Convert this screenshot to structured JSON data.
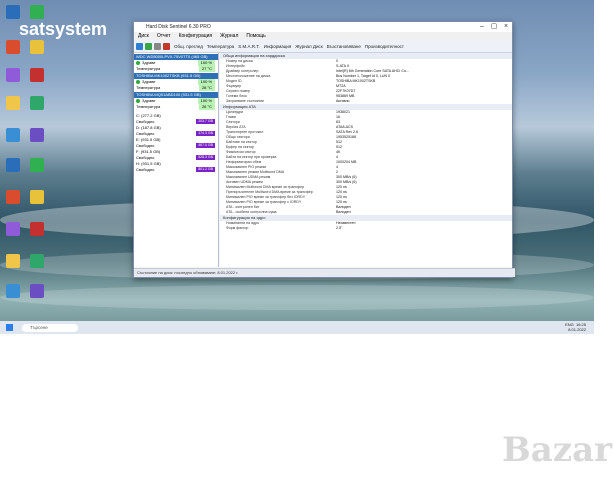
{
  "desktop": {
    "watermark": "satsystem",
    "icons": [
      {
        "label": "",
        "color": "#2a6db8"
      },
      {
        "label": "",
        "color": "#30b050"
      },
      {
        "label": "",
        "color": "#d94d2e"
      },
      {
        "label": "",
        "color": "#e8c23a"
      },
      {
        "label": "",
        "color": "#8f5bd8"
      },
      {
        "label": "",
        "color": "#c23030"
      },
      {
        "label": "",
        "color": "#f0c64a"
      },
      {
        "label": "",
        "color": "#2fa66a"
      },
      {
        "label": "",
        "color": "#3a8fd4"
      },
      {
        "label": "",
        "color": "#6a4ec2"
      }
    ]
  },
  "window": {
    "title": "Hard Disk Sentinel 6.30 PRO",
    "menu": [
      "Диск",
      "Отчет",
      "Конфигурация",
      "Журнал",
      "Помощь"
    ],
    "tabs": [
      "Общ. преглед",
      "Температура",
      "S.M.A.R.T.",
      "Информация",
      "Журнал Диск",
      "Възстановяване",
      "Производителност"
    ],
    "disks": [
      {
        "header": "WDC WD5000LPVX-75V0TT0 (465 GB)",
        "health": "100 %",
        "temp": "27 °C",
        "health_label": "Здраве",
        "temp_label": "Температура"
      },
      {
        "header": "TOSHIBA MK1002TSKB (931.5 GB)",
        "health": "100 %",
        "temp": "28 °C",
        "health_label": "Здраве",
        "temp_label": "Температура"
      },
      {
        "header": "TOSHIBA MQ01ABD100 (931.5 GB)",
        "health": "100 %",
        "temp": "26 °C",
        "health_label": "Здраве",
        "temp_label": "Температура"
      }
    ],
    "partitions": [
      {
        "letter": "C:",
        "size": "(277.2 GB)",
        "free_label": "Свободно",
        "free": "203.7 GB"
      },
      {
        "letter": "D:",
        "size": "(187.8 GB)",
        "free_label": "Свободно",
        "free": "174.3 GB"
      },
      {
        "letter": "E:",
        "size": "(931.5 GB)",
        "free_label": "Свободно",
        "free": "467.0 GB"
      },
      {
        "letter": "F:",
        "size": "(931.5 GB)",
        "free_label": "Свободно",
        "free": "528.3 GB"
      },
      {
        "letter": "H:",
        "size": "(931.5 GB)",
        "free_label": "Свободно",
        "free": "801.2 GB"
      }
    ],
    "info_section1": "Обща информация на харддиска",
    "info1": [
      {
        "k": "Номер на диска",
        "v": "0"
      },
      {
        "k": "Интерфейс",
        "v": "S-ATA II"
      },
      {
        "k": "Драйвер контролер",
        "v": "Intel(R) 6th Generation Core SATA AHCI Co..."
      },
      {
        "k": "Местоположение на диска",
        "v": "Bus Number 1, Target Id 0, LUN 0"
      },
      {
        "k": "Модел ID",
        "v": "TOSHIBA MK1002TSKB"
      },
      {
        "k": "Фърмуер",
        "v": "MT2A"
      },
      {
        "k": "Сериен номер",
        "v": "22F7K07DT"
      },
      {
        "k": "Големи блок",
        "v": "953869 MB"
      },
      {
        "k": "Захранване състояние",
        "v": "Активно"
      }
    ],
    "info_section2": "Информация ATA",
    "info2": [
      {
        "k": "Цилиндри",
        "v": "1938021"
      },
      {
        "k": "Глави",
        "v": "16"
      },
      {
        "k": "Сектори",
        "v": "63"
      },
      {
        "k": "Версия ATA",
        "v": "ATA8-ACS"
      },
      {
        "k": "Транспортен протокол",
        "v": "SATA Rev 2.6"
      },
      {
        "k": "Общо сектори",
        "v": "1953525168"
      },
      {
        "k": "Байтове на сектор",
        "v": "512"
      },
      {
        "k": "Буфер на сектор",
        "v": "512"
      },
      {
        "k": "Физически сектор",
        "v": "4K"
      },
      {
        "k": "Байта на сектор при проверка",
        "v": "4"
      },
      {
        "k": "Неформатиран обем",
        "v": "1000204 MB"
      },
      {
        "k": "Максимален PIO режим",
        "v": "4"
      },
      {
        "k": "Максимален режим Multiword DMA",
        "v": "2"
      },
      {
        "k": "Максимален UDMA режим",
        "v": "300 MB/s (6)"
      },
      {
        "k": "Активен UDMA режим",
        "v": "300 MB/s (6)"
      },
      {
        "k": "Минимален Multiword DMA време за трансфер",
        "v": "120 ns"
      },
      {
        "k": "Препоръчителен Multiword DMA време за трансфер",
        "v": "120 ns"
      },
      {
        "k": "Минимален PIO време за трансфер без IORDY",
        "v": "120 ns"
      },
      {
        "k": "Минимален PIO време за трансфер с IORDY",
        "v": "120 ns"
      },
      {
        "k": "ATA - контролен бит",
        "v": "Валиден"
      },
      {
        "k": "ATA - особени контролна сума",
        "v": "Валиден"
      }
    ],
    "info_section3": "Конфигурация на ядро",
    "info3": [
      {
        "k": "Номинални на ядро",
        "v": "Неизвестен"
      },
      {
        "k": "Форм фактор",
        "v": "2.5\""
      }
    ],
    "status": "Състояние на диск: последно обновяване: 8.01.2022 г."
  },
  "taskbar": {
    "search_placeholder": "Търсене",
    "time": "16:25",
    "date": "8.01.2022",
    "lang": "ENG"
  },
  "logo": "Bazar"
}
